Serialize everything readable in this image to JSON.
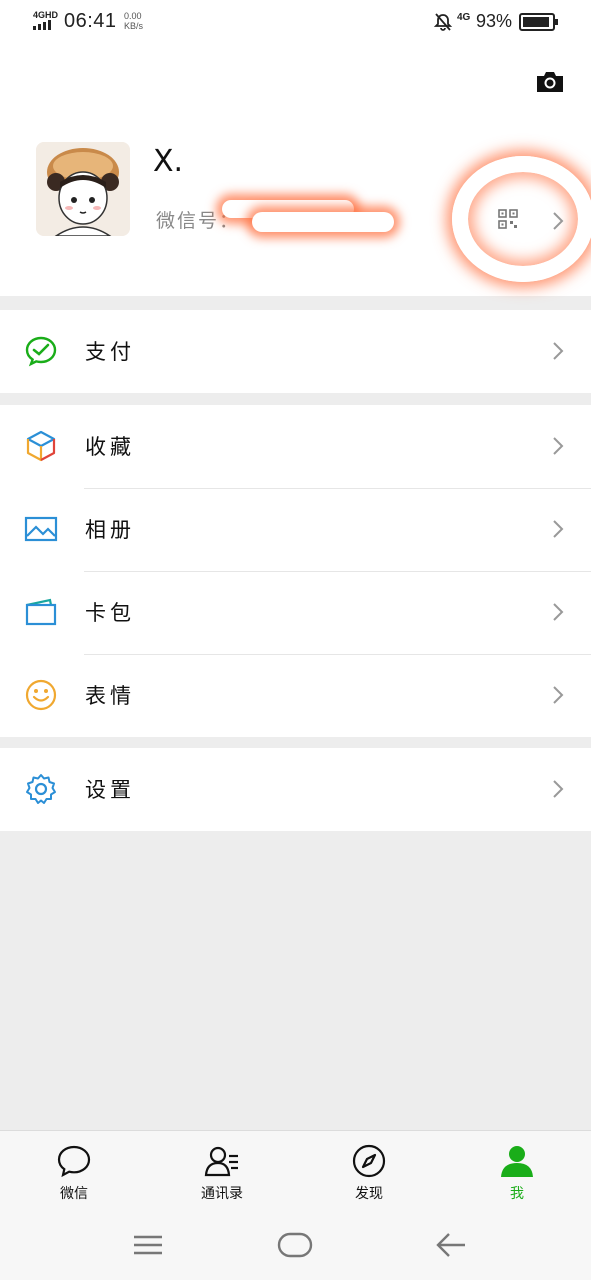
{
  "status_bar": {
    "network_label": "4GHD",
    "time": "06:41",
    "speed_value": "0.00",
    "speed_unit": "KB/s",
    "cell_label": "4G",
    "battery_percent": "93%",
    "battery_level": 0.93
  },
  "profile": {
    "nickname": "X.",
    "wechat_id_label": "微信号：",
    "camera_icon": "camera-icon",
    "qr_icon": "qr-code-icon"
  },
  "menu": {
    "pay": {
      "label": "支付",
      "icon": "pay-icon",
      "color": "#1aad19"
    },
    "favorites": {
      "label": "收藏",
      "icon": "cube-icon"
    },
    "album": {
      "label": "相册",
      "icon": "photo-icon",
      "color": "#2b8fd6"
    },
    "cards": {
      "label": "卡包",
      "icon": "wallet-icon",
      "color": "#2b8fd6"
    },
    "stickers": {
      "label": "表情",
      "icon": "smiley-icon",
      "color": "#f0a830"
    },
    "settings": {
      "label": "设置",
      "icon": "gear-icon",
      "color": "#2b8fd6"
    }
  },
  "tabs": [
    {
      "label": "微信",
      "icon": "chat-bubble-icon"
    },
    {
      "label": "通讯录",
      "icon": "contacts-icon"
    },
    {
      "label": "发现",
      "icon": "compass-icon"
    },
    {
      "label": "我",
      "icon": "person-icon",
      "active": true
    }
  ],
  "colors": {
    "accent": "#1aad19",
    "background": "#ededed"
  }
}
